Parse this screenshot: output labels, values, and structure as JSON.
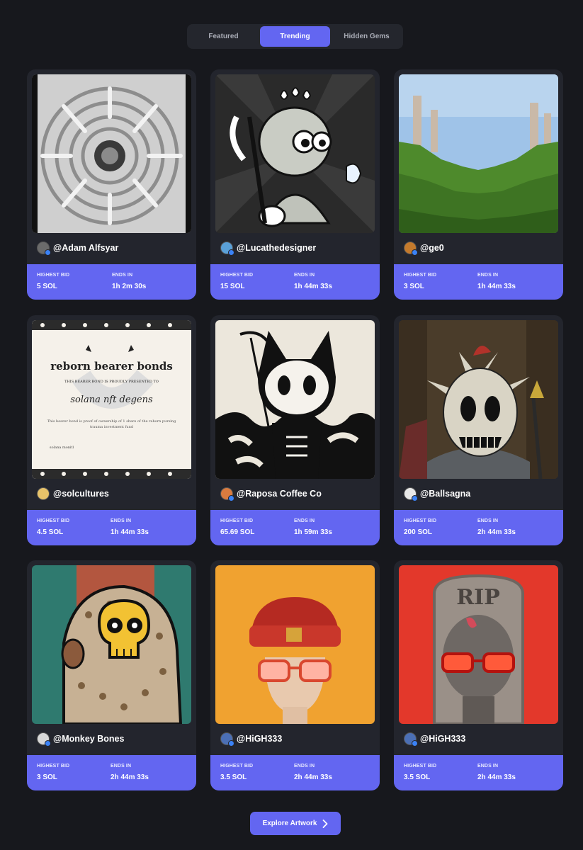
{
  "tabs": [
    {
      "label": "Featured",
      "active": false
    },
    {
      "label": "Trending",
      "active": true
    },
    {
      "label": "Hidden Gems",
      "active": false
    }
  ],
  "labels": {
    "highest_bid": "HIGHEST BID",
    "ends_in": "ENDS IN"
  },
  "cards": [
    {
      "owner": "@Adam Alfsyar",
      "bid": "5 SOL",
      "ends": "1h 2m 30s",
      "avatar_color": "#6b6b6b"
    },
    {
      "owner": "@Lucathedesigner",
      "bid": "15 SOL",
      "ends": "1h 44m 33s",
      "avatar_color": "#5aa0d8"
    },
    {
      "owner": "@ge0",
      "bid": "3 SOL",
      "ends": "1h 44m 33s",
      "avatar_color": "#c47a2c"
    },
    {
      "owner": "@solcultures",
      "bid": "4.5 SOL",
      "ends": "1h 44m 33s",
      "avatar_color": "#e8c36a"
    },
    {
      "owner": "@Raposa Coffee Co",
      "bid": "65.69 SOL",
      "ends": "1h 59m 33s",
      "avatar_color": "#d97b3f"
    },
    {
      "owner": "@Ballsagna",
      "bid": "200 SOL",
      "ends": "2h 44m 33s",
      "avatar_color": "#e8e8e8"
    },
    {
      "owner": "@Monkey Bones",
      "bid": "3 SOL",
      "ends": "2h 44m 33s",
      "avatar_color": "#d8d8d8"
    },
    {
      "owner": "@HiGH333",
      "bid": "3.5 SOL",
      "ends": "2h 44m 33s",
      "avatar_color": "#4b6fb5"
    },
    {
      "owner": "@HiGH333",
      "bid": "3.5 SOL",
      "ends": "2h 44m 33s",
      "avatar_color": "#4b6fb5"
    }
  ],
  "certificate": {
    "title": "reborn bearer bonds",
    "presented": "THIS BEARER BOND IS PROUDLY PRESENTED TO",
    "recipient": "solana nft degens",
    "body": "This bearer bond is proof of ownership of 1 share of the reborn pursing",
    "body2": "trauma investment fund",
    "sign": "solana monitl"
  },
  "tombstone_text": "RIP",
  "explore_label": "Explore Artwork",
  "colors": {
    "accent": "#6366f1",
    "background": "#17181d",
    "card": "#23252d"
  }
}
